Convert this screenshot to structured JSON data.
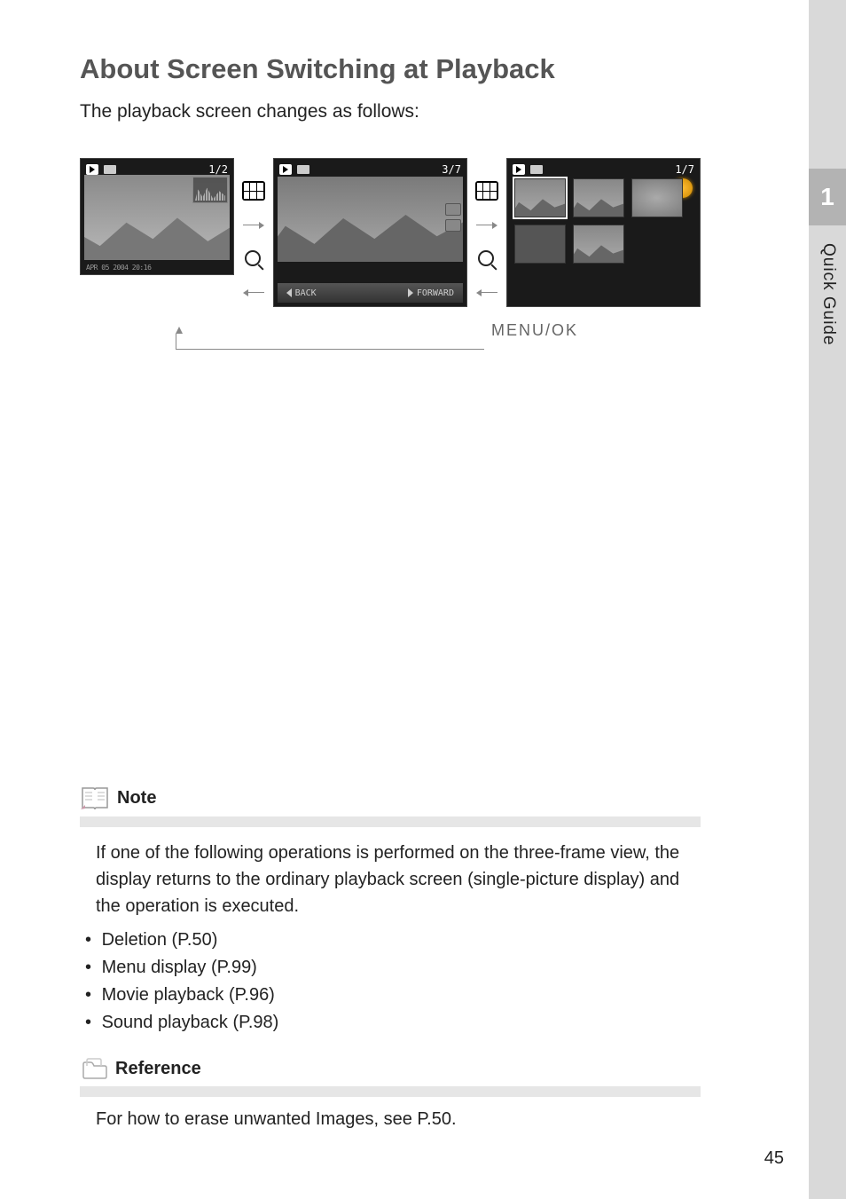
{
  "section_title": "About Screen Switching at Playback",
  "lead_text": "The playback screen changes as follows:",
  "screen1": {
    "counter": "1/2",
    "date": "APR 05 2004 20:16"
  },
  "screen2": {
    "counter": "3/7",
    "back": "BACK",
    "forward": "FORWARD"
  },
  "screen3": {
    "counter": "1/7"
  },
  "menu_ok": "MENU/OK",
  "side_tab": {
    "num": "1",
    "label": "Quick Guide"
  },
  "note": {
    "title": "Note",
    "body": "If one of the following operations is performed on the three-frame view, the display returns to the ordinary playback screen (single-picture display) and the operation is executed.",
    "items": [
      "Deletion (P.50)",
      "Menu display (P.99)",
      "Movie playback (P.96)",
      "Sound playback (P.98)"
    ]
  },
  "reference": {
    "title": "Reference",
    "body": "For how to erase unwanted Images, see P.50."
  },
  "page_num": "45"
}
